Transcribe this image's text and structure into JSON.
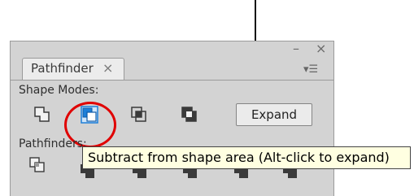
{
  "panel": {
    "tab_label": "Pathfinder",
    "tab_close_glyph": "×",
    "minimize_glyph": "–",
    "close_glyph": "×",
    "menu_glyph": "▾☰"
  },
  "shape_modes": {
    "label": "Shape Modes:",
    "tools": [
      {
        "name": "unite-icon"
      },
      {
        "name": "minus-front-icon",
        "highlighted": true
      },
      {
        "name": "intersect-icon"
      },
      {
        "name": "exclude-icon"
      }
    ],
    "expand_label": "Expand"
  },
  "pathfinders": {
    "label": "Pathfinders:"
  },
  "tooltip": {
    "text": "Subtract from shape area (Alt-click to expand)"
  },
  "colors": {
    "panel_bg": "#d3d3d3",
    "highlight_circle": "#e00000",
    "tooltip_bg": "#ffffe1",
    "tool_selected": "#1e7fd8"
  }
}
